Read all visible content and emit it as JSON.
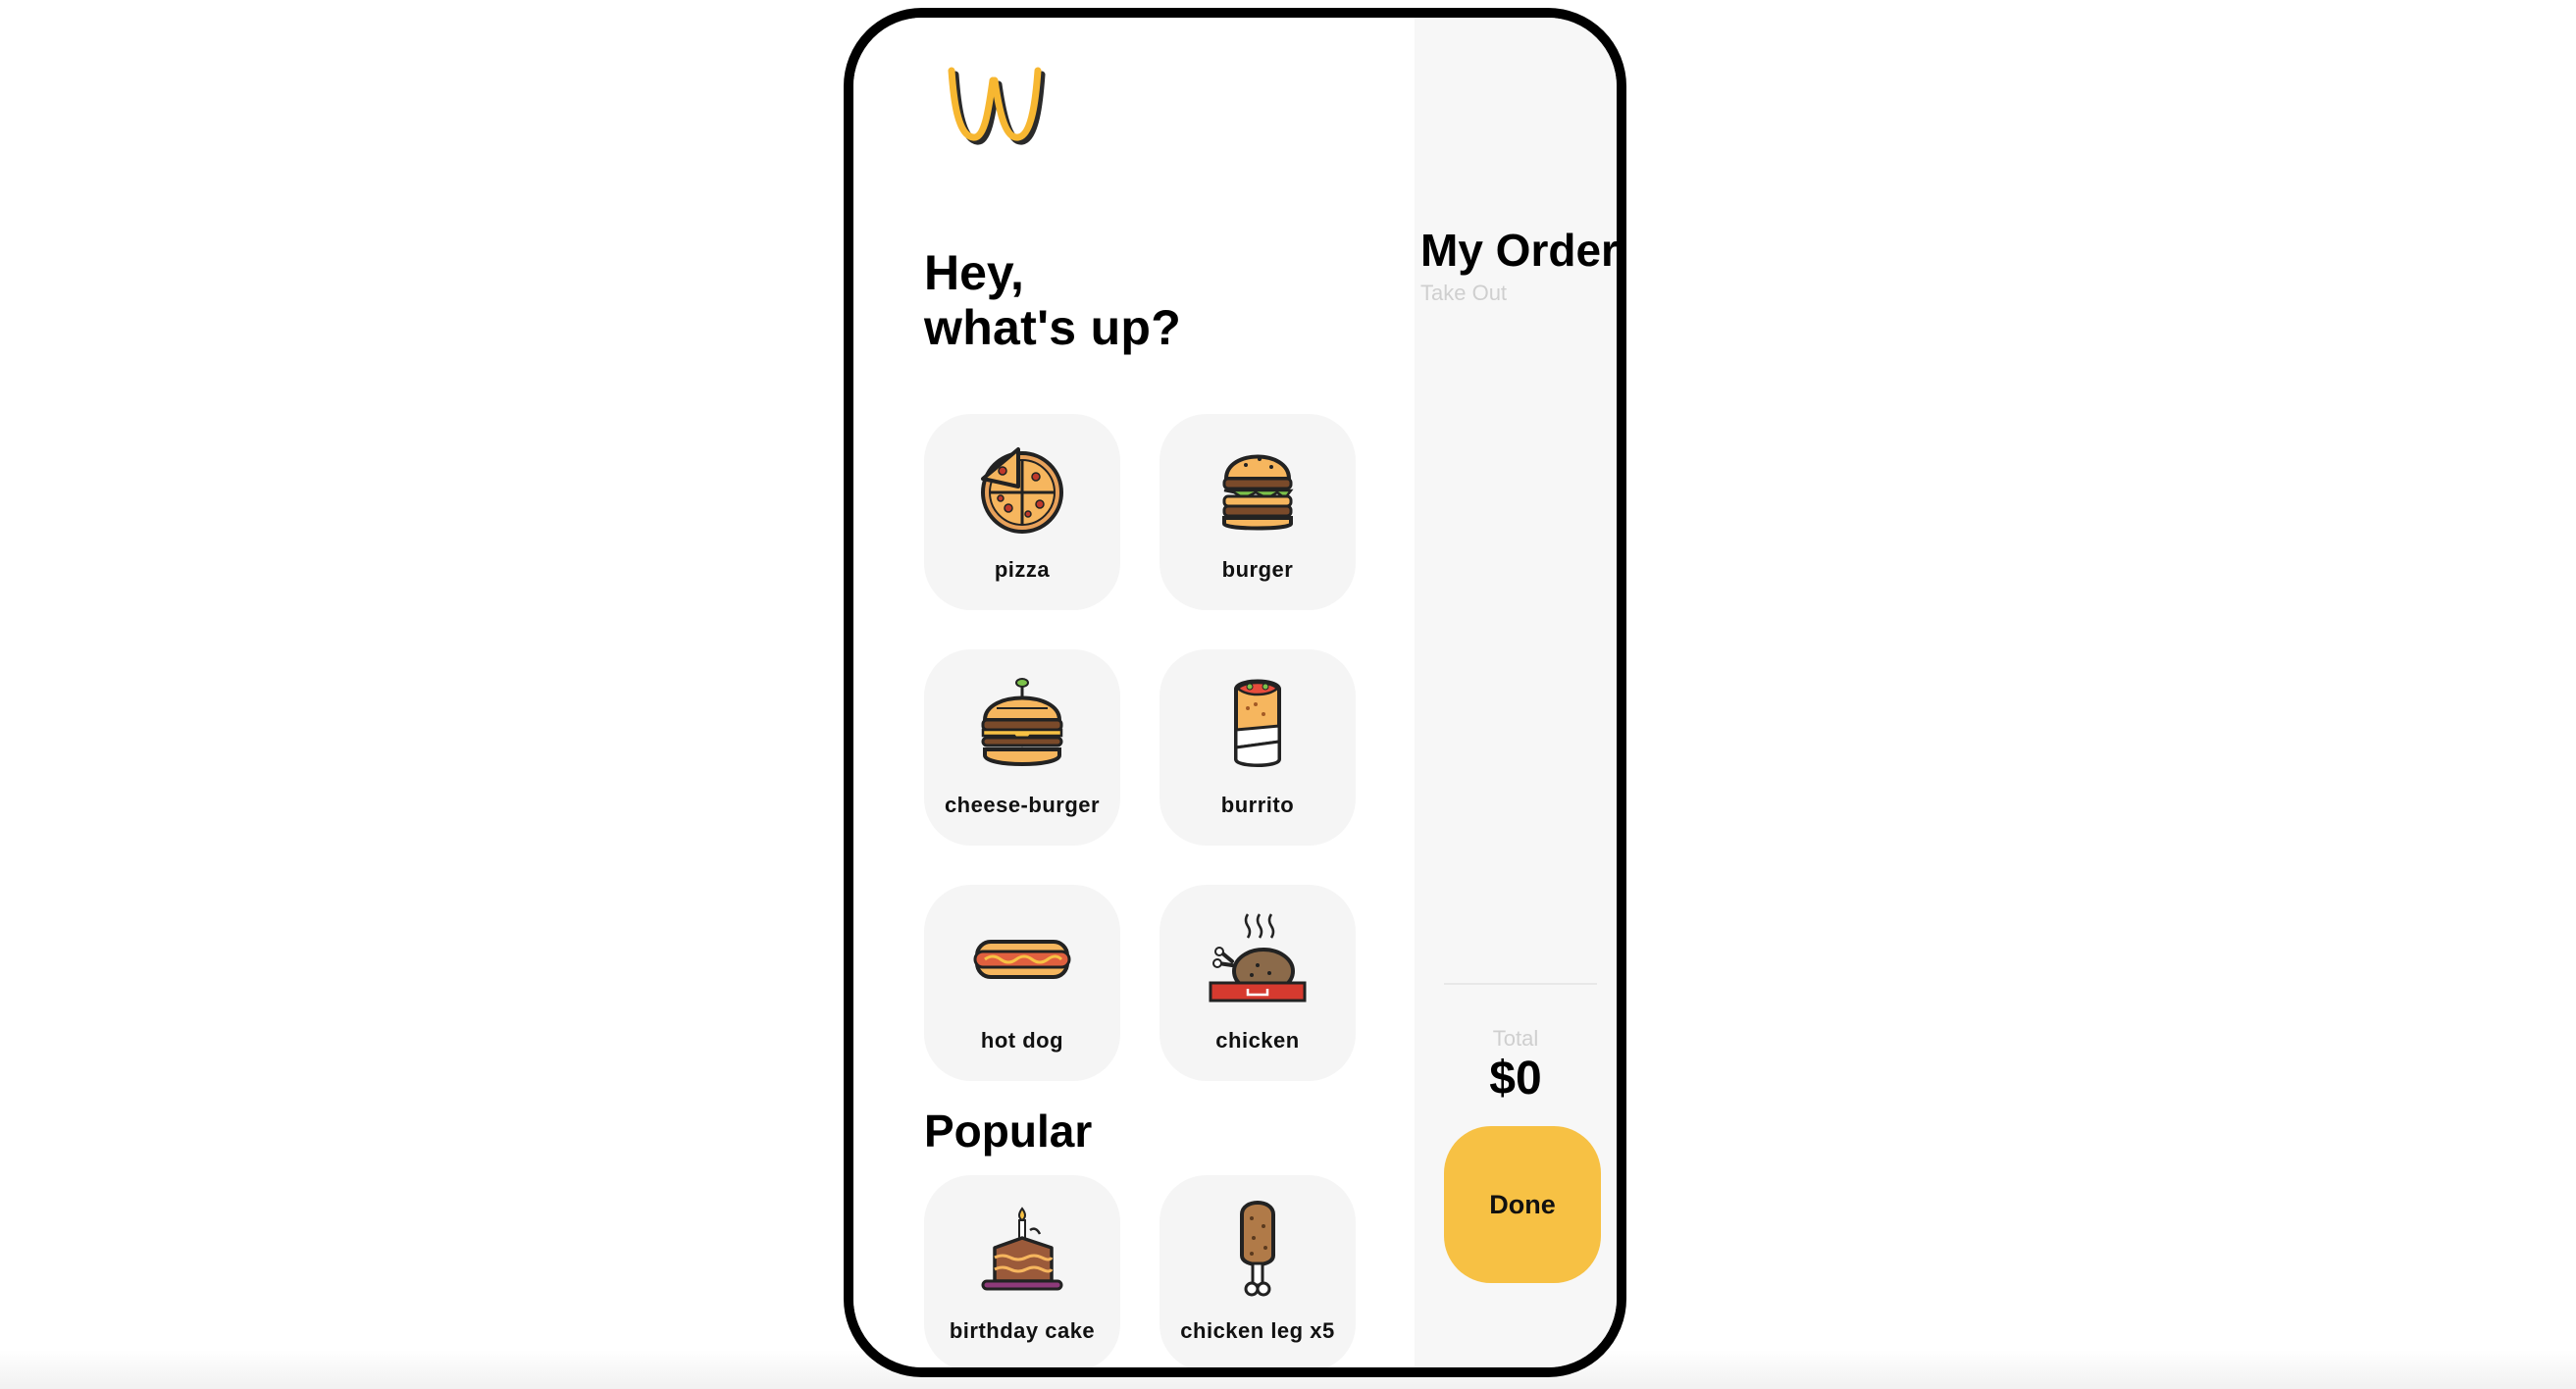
{
  "greeting": {
    "line1": "Hey,",
    "line2": "what's up?"
  },
  "categories": [
    {
      "label": "pizza",
      "icon": "pizza-icon"
    },
    {
      "label": "burger",
      "icon": "burger-icon"
    },
    {
      "label": "cheese-burger",
      "icon": "cheese-burger-icon"
    },
    {
      "label": "burrito",
      "icon": "burrito-icon"
    },
    {
      "label": "hot dog",
      "icon": "hot-dog-icon"
    },
    {
      "label": "chicken",
      "icon": "chicken-icon"
    }
  ],
  "popular": {
    "title": "Popular",
    "items": [
      {
        "label": "birthday cake",
        "icon": "birthday-cake-icon"
      },
      {
        "label": "chicken leg x5",
        "icon": "chicken-leg-icon"
      }
    ]
  },
  "order": {
    "title": "My Order",
    "subtitle": "Take Out",
    "total_label": "Total",
    "total_value": "$0",
    "done_label": "Done"
  },
  "colors": {
    "accent": "#f7c144",
    "tile_bg": "#f5f5f5",
    "panel_bg": "#f7f7f7",
    "muted_text": "#cfcfcf"
  }
}
